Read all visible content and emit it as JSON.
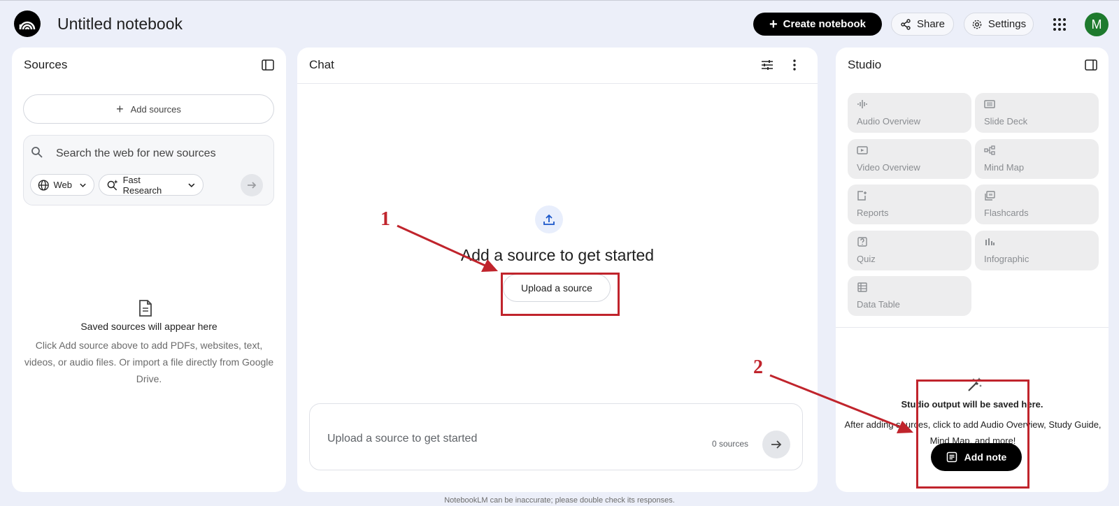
{
  "app": {
    "title": "Untitled notebook",
    "avatar_letter": "M",
    "avatar_color": "#1e7a2e"
  },
  "header": {
    "create_label": "Create notebook",
    "share_label": "Share",
    "settings_label": "Settings"
  },
  "sources": {
    "title": "Sources",
    "add_label": "Add sources",
    "search_placeholder": "Search the web for new sources",
    "chip_web": "Web",
    "chip_research": "Fast Research",
    "empty_title": "Saved sources will appear here",
    "empty_body": "Click Add source above to add PDFs, websites, text, videos, or audio files. Or import a file directly from Google Drive."
  },
  "chat": {
    "title": "Chat",
    "empty_title": "Add a source to get started",
    "upload_label": "Upload a source",
    "input_placeholder": "Upload a source to get started",
    "source_count": "0 sources"
  },
  "studio": {
    "title": "Studio",
    "tiles": [
      {
        "label": "Audio Overview",
        "icon": "audio-wave-icon"
      },
      {
        "label": "Slide Deck",
        "icon": "slides-icon"
      },
      {
        "label": "Video Overview",
        "icon": "video-icon"
      },
      {
        "label": "Mind Map",
        "icon": "mind-map-icon"
      },
      {
        "label": "Reports",
        "icon": "report-icon"
      },
      {
        "label": "Flashcards",
        "icon": "flashcards-icon"
      },
      {
        "label": "Quiz",
        "icon": "quiz-icon"
      },
      {
        "label": "Infographic",
        "icon": "infographic-icon"
      },
      {
        "label": "Data Table",
        "icon": "table-icon"
      }
    ],
    "output_title": "Studio output will be saved here.",
    "output_body": "After adding sources, click to add Audio Overview, Study Guide, Mind Map, and more!",
    "add_note_label": "Add note"
  },
  "footer": {
    "disclaimer": "NotebookLM can be inaccurate; please double check its responses."
  },
  "annotations": {
    "marker_1": "1",
    "marker_2": "2",
    "color": "#c0242c"
  }
}
